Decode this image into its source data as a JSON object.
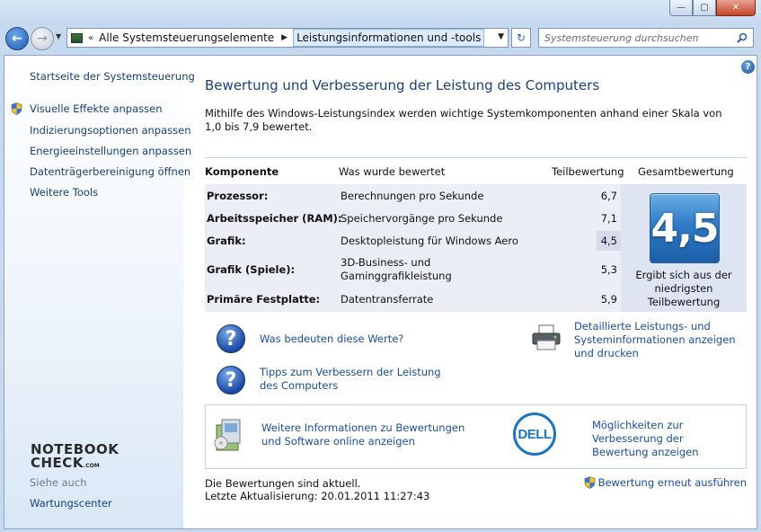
{
  "window": {
    "minimize_glyph": "—",
    "maximize_glyph": "▢",
    "close_glyph": "✕"
  },
  "navbar": {
    "back_glyph": "←",
    "forward_glyph": "→",
    "history_glyph": "▼",
    "breadcrumb_prefix": "«",
    "breadcrumbs": [
      "Alle Systemsteuerungselemente",
      "Leistungsinformationen und -tools"
    ],
    "breadcrumb_sep": "▶",
    "dropdown_glyph": "▼",
    "refresh_glyph": "↻",
    "search_placeholder": "Systemsteuerung durchsuchen"
  },
  "sidebar": {
    "items": [
      {
        "label": "Startseite der Systemsteuerung",
        "icon": null
      },
      {
        "label": "Visuelle Effekte anpassen",
        "icon": "shield-icon"
      },
      {
        "label": "Indizierungsoptionen anpassen",
        "icon": null
      },
      {
        "label": "Energieeinstellungen anpassen",
        "icon": null
      },
      {
        "label": "Datenträgerbereinigung öffnen",
        "icon": null
      },
      {
        "label": "Weitere Tools",
        "icon": null
      }
    ],
    "logo_line1": "NOTEBOOK",
    "logo_line2": "CHECK",
    "logo_suffix": ".COM",
    "see_also_label": "Siehe auch",
    "see_also_items": [
      {
        "label": "Wartungscenter"
      }
    ]
  },
  "main": {
    "help_glyph": "?",
    "title": "Bewertung und Verbesserung der Leistung des Computers",
    "description": "Mithilfe des Windows-Leistungsindex werden wichtige Systemkomponenten anhand einer Skala von 1,0 bis 7,9 bewertet.",
    "table": {
      "headers": {
        "component": "Komponente",
        "assessed": "Was wurde bewertet",
        "subscore": "Teilbewertung",
        "basescore": "Gesamtbewertung"
      },
      "rows": [
        {
          "component": "Prozessor:",
          "assessed": "Berechnungen pro Sekunde",
          "score": "6,7"
        },
        {
          "component": "Arbeitsspeicher (RAM):",
          "assessed": "Speichervorgänge pro Sekunde",
          "score": "7,1"
        },
        {
          "component": "Grafik:",
          "assessed": "Desktopleistung für Windows Aero",
          "score": "4,5"
        },
        {
          "component": "Grafik (Spiele):",
          "assessed": "3D-Business- und Gaminggrafikleistung",
          "score": "5,3"
        },
        {
          "component": "Primäre Festplatte:",
          "assessed": "Datentransferrate",
          "score": "5,9"
        }
      ],
      "base_score": "4,5",
      "base_caption": "Ergibt sich aus der niedrigsten Teilbewertung"
    },
    "links": {
      "what_mean": "Was bedeuten diese Werte?",
      "tips": "Tipps zum Verbessern der Leistung des Computers",
      "details": "Detaillierte Leistungs- und Systeminformationen anzeigen und drucken",
      "more_info": "Weitere Informationen zu Bewertungen und Software online anzeigen",
      "oem": "Möglichkeiten zur Verbesserung der Bewertung anzeigen"
    },
    "question_glyph": "?",
    "dell_logo": "DELL",
    "status_line1": "Die Bewertungen sind aktuell.",
    "status_line2": "Letzte Aktualisierung: 20.01.2011 11:27:43",
    "rerun_label": "Bewertung erneut ausführen"
  }
}
